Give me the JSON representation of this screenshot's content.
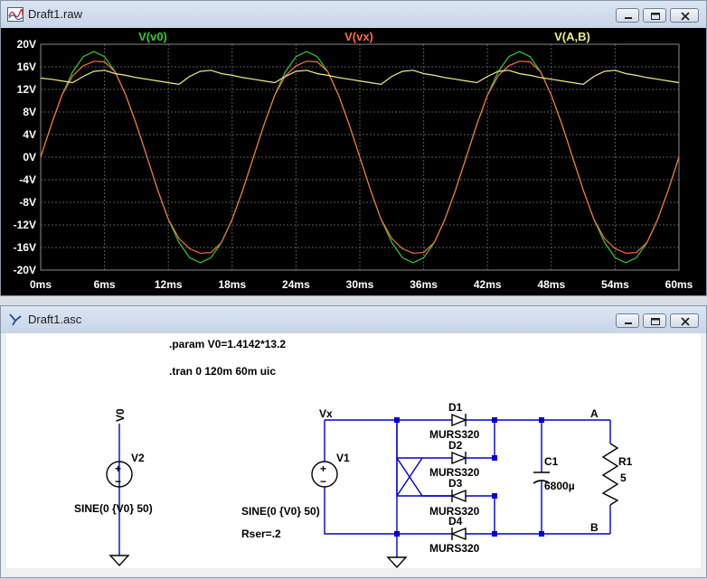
{
  "waveform_window": {
    "title": "Draft1.raw",
    "buttons": [
      "minimize",
      "maximize",
      "close"
    ]
  },
  "schematic_window": {
    "title": "Draft1.asc",
    "buttons": [
      "minimize",
      "maximize",
      "close"
    ]
  },
  "chart_data": {
    "type": "line",
    "background": "#000000",
    "x_unit": "ms",
    "xlim": [
      0,
      60
    ],
    "ylim": [
      -20,
      20
    ],
    "xticks": [
      "0ms",
      "6ms",
      "12ms",
      "18ms",
      "24ms",
      "30ms",
      "36ms",
      "42ms",
      "48ms",
      "54ms",
      "60ms"
    ],
    "yticks": [
      "20V",
      "16V",
      "12V",
      "8V",
      "4V",
      "0V",
      "-4V",
      "-8V",
      "-12V",
      "-16V",
      "-20V"
    ],
    "grid": true,
    "series": [
      {
        "name": "V(v0)",
        "color": "#33cc33",
        "x": [
          0,
          1,
          2,
          3,
          4,
          5,
          6,
          7,
          8,
          9,
          10,
          11,
          12,
          13,
          14,
          15,
          16,
          17,
          18,
          19,
          20,
          21,
          22,
          23,
          24,
          25,
          26,
          27,
          28,
          29,
          30,
          31,
          32,
          33,
          34,
          35,
          36,
          37,
          38,
          39,
          40,
          41,
          42,
          43,
          44,
          45,
          46,
          47,
          48,
          49,
          50,
          51,
          52,
          53,
          54,
          55,
          56,
          57,
          58,
          59,
          60
        ],
        "y": [
          0,
          5.8,
          11,
          15.1,
          17.8,
          18.7,
          17.8,
          15.1,
          11,
          5.8,
          0,
          -5.8,
          -11,
          -15.1,
          -17.8,
          -18.7,
          -17.8,
          -15.1,
          -11,
          -5.8,
          0,
          5.8,
          11,
          15.1,
          17.8,
          18.7,
          17.8,
          15.1,
          11,
          5.8,
          0,
          -5.8,
          -11,
          -15.1,
          -17.8,
          -18.7,
          -17.8,
          -15.1,
          -11,
          -5.8,
          0,
          5.8,
          11,
          15.1,
          17.8,
          18.7,
          17.8,
          15.1,
          11,
          5.8,
          0,
          -5.8,
          -11,
          -15.1,
          -17.8,
          -18.7,
          -17.8,
          -15.1,
          -11,
          -5.8,
          0
        ]
      },
      {
        "name": "V(vx)",
        "color": "#ff7040",
        "x": [
          0,
          1,
          2,
          3,
          4,
          5,
          6,
          7,
          8,
          9,
          10,
          11,
          12,
          13,
          14,
          15,
          16,
          17,
          18,
          19,
          20,
          21,
          22,
          23,
          24,
          25,
          26,
          27,
          28,
          29,
          30,
          31,
          32,
          33,
          34,
          35,
          36,
          37,
          38,
          39,
          40,
          41,
          42,
          43,
          44,
          45,
          46,
          47,
          48,
          49,
          50,
          51,
          52,
          53,
          54,
          55,
          56,
          57,
          58,
          59,
          60
        ],
        "y": [
          0,
          5.8,
          11,
          14.4,
          16.2,
          17,
          16.9,
          15.1,
          11,
          5.8,
          0,
          -5.8,
          -11,
          -14.4,
          -16.2,
          -17,
          -16.9,
          -15.1,
          -11,
          -5.8,
          0,
          5.8,
          11,
          14.4,
          16.2,
          17,
          16.9,
          15.1,
          11,
          5.8,
          0,
          -5.8,
          -11,
          -14.4,
          -16.2,
          -17,
          -16.9,
          -15.1,
          -11,
          -5.8,
          0,
          5.8,
          11,
          14.4,
          16.2,
          17,
          16.9,
          15.1,
          11,
          5.8,
          0,
          -5.8,
          -11,
          -14.4,
          -16.2,
          -17,
          -16.9,
          -15.1,
          -11,
          -5.8,
          0
        ]
      },
      {
        "name": "V(A,B)",
        "color": "#f0f080",
        "x": [
          0,
          1,
          2,
          3,
          4,
          5,
          6,
          7,
          8,
          9,
          10,
          11,
          12,
          13,
          14,
          15,
          16,
          17,
          18,
          19,
          20,
          21,
          22,
          23,
          24,
          25,
          26,
          27,
          28,
          29,
          30,
          31,
          32,
          33,
          34,
          35,
          36,
          37,
          38,
          39,
          40,
          41,
          42,
          43,
          44,
          45,
          46,
          47,
          48,
          49,
          50,
          51,
          52,
          53,
          54,
          55,
          56,
          57,
          58,
          59,
          60
        ],
        "y": [
          14,
          13.8,
          13.5,
          13.2,
          14.3,
          15.2,
          15.4,
          14.8,
          14.5,
          14.1,
          13.8,
          13.5,
          13.2,
          12.9,
          14.3,
          15.2,
          15.4,
          14.8,
          14.5,
          14.1,
          13.8,
          13.5,
          13.2,
          14.3,
          15.2,
          15.4,
          14.8,
          14.5,
          14.1,
          13.8,
          13.5,
          13.2,
          12.9,
          14.3,
          15.2,
          15.4,
          14.8,
          14.5,
          14.1,
          13.8,
          13.5,
          13.2,
          14.3,
          15.2,
          15.4,
          14.8,
          14.5,
          14.1,
          13.8,
          13.5,
          13.2,
          12.9,
          14.3,
          15.2,
          15.4,
          14.8,
          14.5,
          14.1,
          13.8,
          13.5,
          13.2
        ]
      }
    ]
  },
  "schematic": {
    "directive_param": ".param V0=1.4142*13.2",
    "directive_tran": ".tran 0 120m 60m uic",
    "v0_net": "V0",
    "v2_name": "V2",
    "v2_value": "SINE(0 {V0} 50)",
    "vx_net": "Vx",
    "v1_name": "V1",
    "v1_value": "SINE(0 {V0} 50)",
    "v1_rser": "Rser=.2",
    "d1_name": "D1",
    "d1_model": "MURS320",
    "d2_name": "D2",
    "d2_model": "MURS320",
    "d3_name": "D3",
    "d3_model": "MURS320",
    "d4_name": "D4",
    "d4_model": "MURS320",
    "c1_name": "C1",
    "c1_value": "6800µ",
    "r1_name": "R1",
    "r1_value": "5",
    "node_a": "A",
    "node_b": "B",
    "plus_sign": "+",
    "minus_sign": "−"
  }
}
